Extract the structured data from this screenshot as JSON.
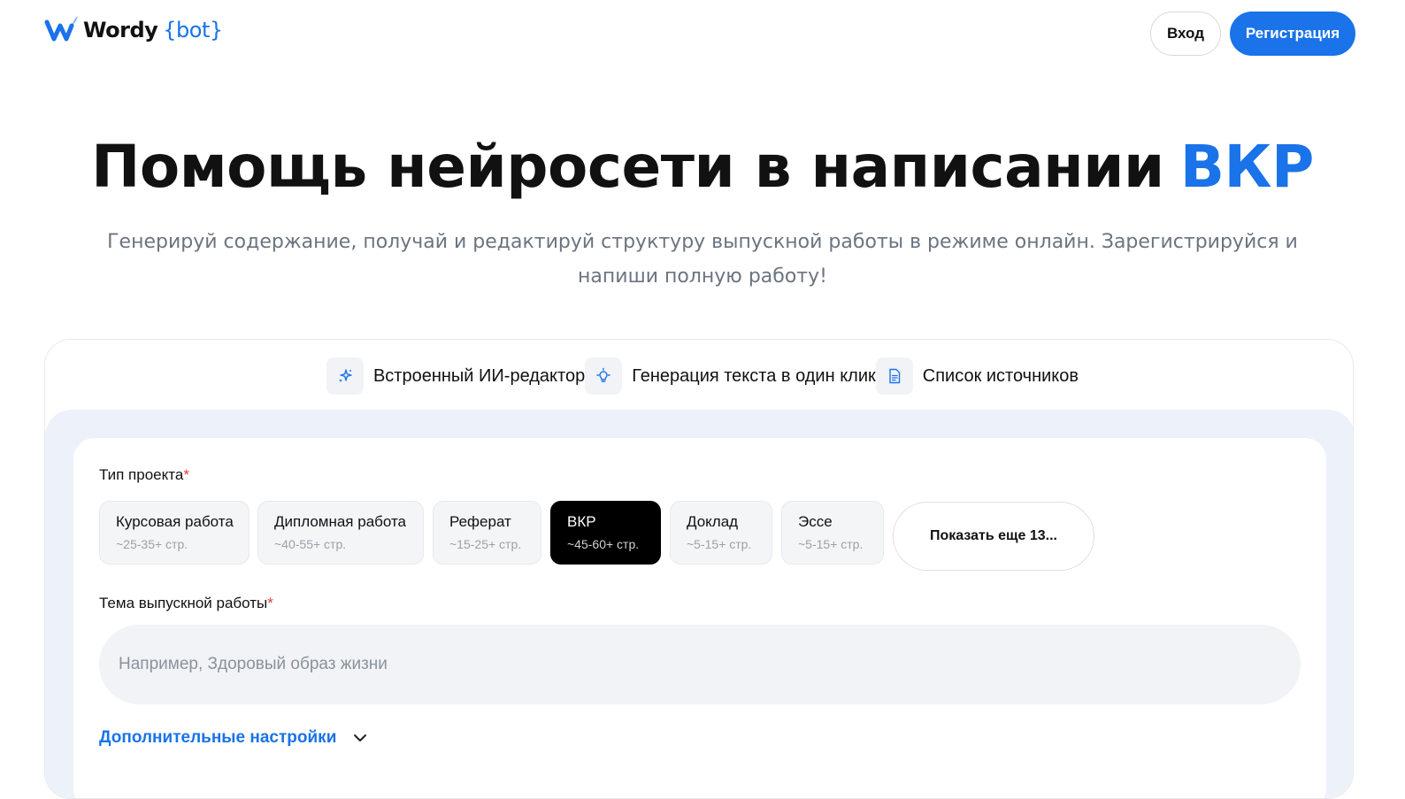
{
  "header": {
    "logo_text": "Wordy",
    "logo_accent": "{bot}",
    "login_label": "Вход",
    "register_label": "Регистрация"
  },
  "hero": {
    "title": "Помощь нейросети в написании",
    "title_accent": "ВКР",
    "subtitle": "Генерируй содержание, получай и редактируй структуру выпускной работы в режиме онлайн. Зарегистрируйся и напиши полную работу!"
  },
  "features": [
    {
      "label": "Встроенный ИИ-редактор",
      "icon": "sparkle-icon"
    },
    {
      "label": "Генерация текста в один клик",
      "icon": "lightbulb-icon"
    },
    {
      "label": "Список источников",
      "icon": "document-icon"
    }
  ],
  "form": {
    "project_type_label": "Тип проекта",
    "required_mark": "*",
    "project_types": [
      {
        "name": "Курсовая работа",
        "pages": "~25-35+ стр.",
        "selected": false
      },
      {
        "name": "Дипломная работа",
        "pages": "~40-55+ стр.",
        "selected": false
      },
      {
        "name": "Реферат",
        "pages": "~15-25+ стр.",
        "selected": false
      },
      {
        "name": "ВКР",
        "pages": "~45-60+ стр.",
        "selected": true
      },
      {
        "name": "Доклад",
        "pages": "~5-15+ стр.",
        "selected": false
      },
      {
        "name": "Эссе",
        "pages": "~5-15+ стр.",
        "selected": false
      }
    ],
    "show_more_label": "Показать еще 13...",
    "topic_label": "Тема выпускной работы",
    "topic_value": "",
    "topic_placeholder": "Например, Здоровый образ жизни",
    "advanced_label": "Дополнительные настройки",
    "advanced_icon": "chevron-down-icon"
  },
  "colors": {
    "accent": "#1a73e8",
    "required": "#e53935",
    "selected_chip": "#000000",
    "panel_bg": "#edf2fa"
  }
}
